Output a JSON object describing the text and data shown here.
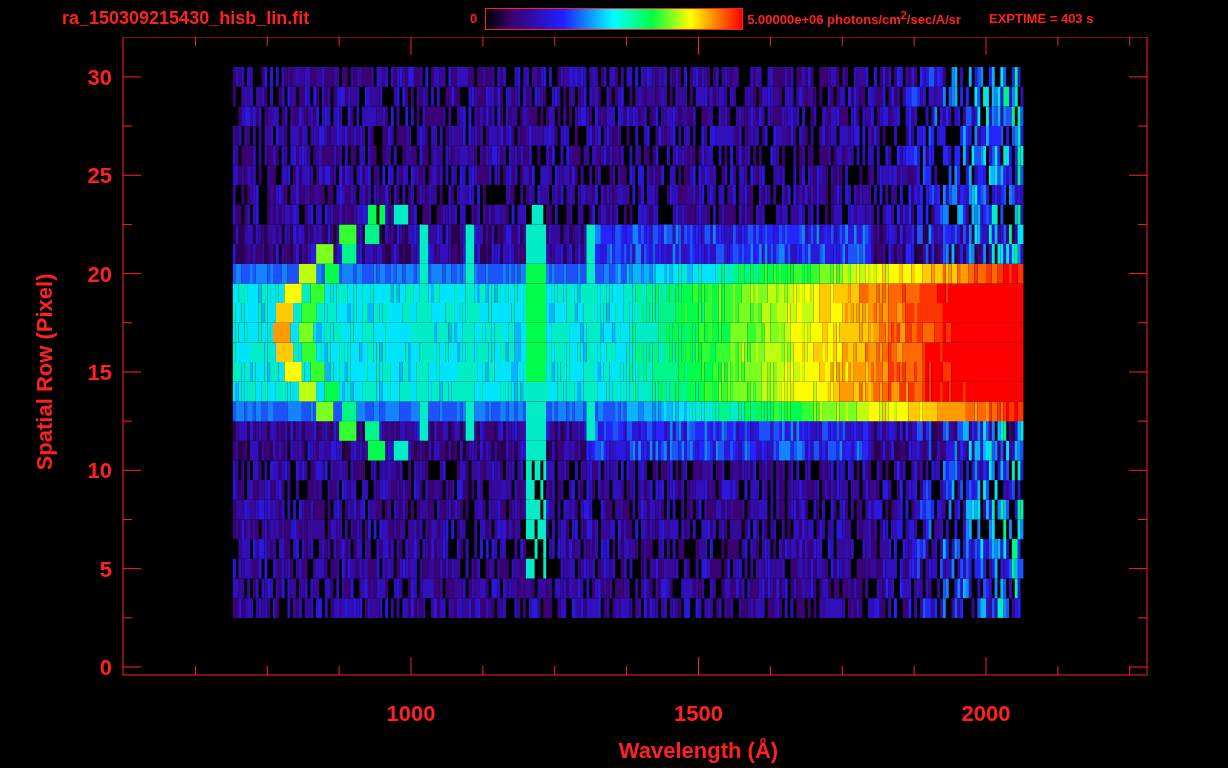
{
  "title": "ra_150309215430_hisb_lin.fit",
  "colorbar": {
    "min_label": "0",
    "max_label": "5.00000e+06 photons/cm$^{2}$/sec/A/sr"
  },
  "exposure": "EXPTIME = 403 s",
  "plot": {
    "ylabel": "Spatial Row (Pixel)",
    "xlabel": "Wavelength (Å)",
    "yticks": [
      "30",
      "25",
      "20",
      "15",
      "10",
      "5",
      "0"
    ],
    "xticks": [
      "1000",
      "1500",
      "2000"
    ]
  }
}
